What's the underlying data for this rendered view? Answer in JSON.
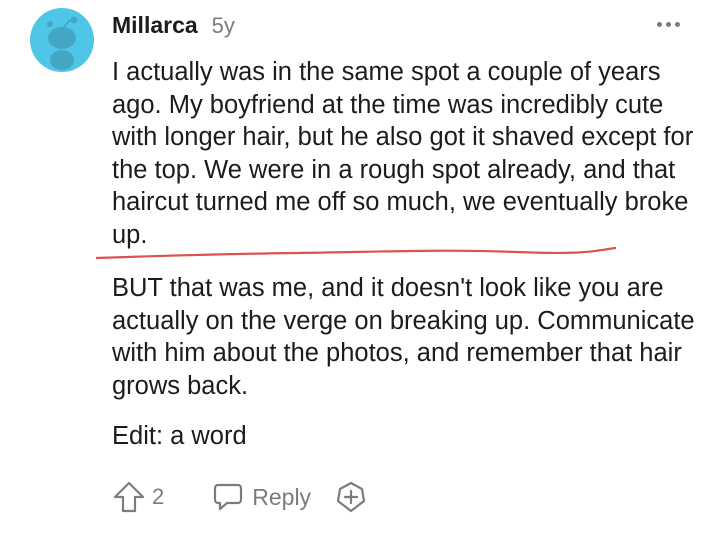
{
  "comment": {
    "username": "Millarca",
    "age": "5y",
    "paragraphs": [
      "I actually was in the same spot a couple of years ago. My boyfriend at the time was incredibly cute with longer hair, but he also got it shaved except for the top. We were in a rough spot already, and that haircut turned me off so much, we eventually broke up.",
      "BUT that was me, and it doesn't look like you are actually on the verge on breaking up. Communicate with him about the photos, and remember that hair grows back.",
      "Edit: a word"
    ]
  },
  "actions": {
    "upvote_count": "2",
    "reply_label": "Reply"
  },
  "colors": {
    "avatar_bg": "#4fc6e8",
    "muted": "#7c7c7c",
    "annotation_line": "#d9534f"
  },
  "icons": {
    "avatar": "snoo-avatar-icon",
    "more": "more-dots-icon",
    "upvote": "upvote-arrow-icon",
    "reply": "speech-bubble-icon",
    "award": "award-plus-icon"
  }
}
